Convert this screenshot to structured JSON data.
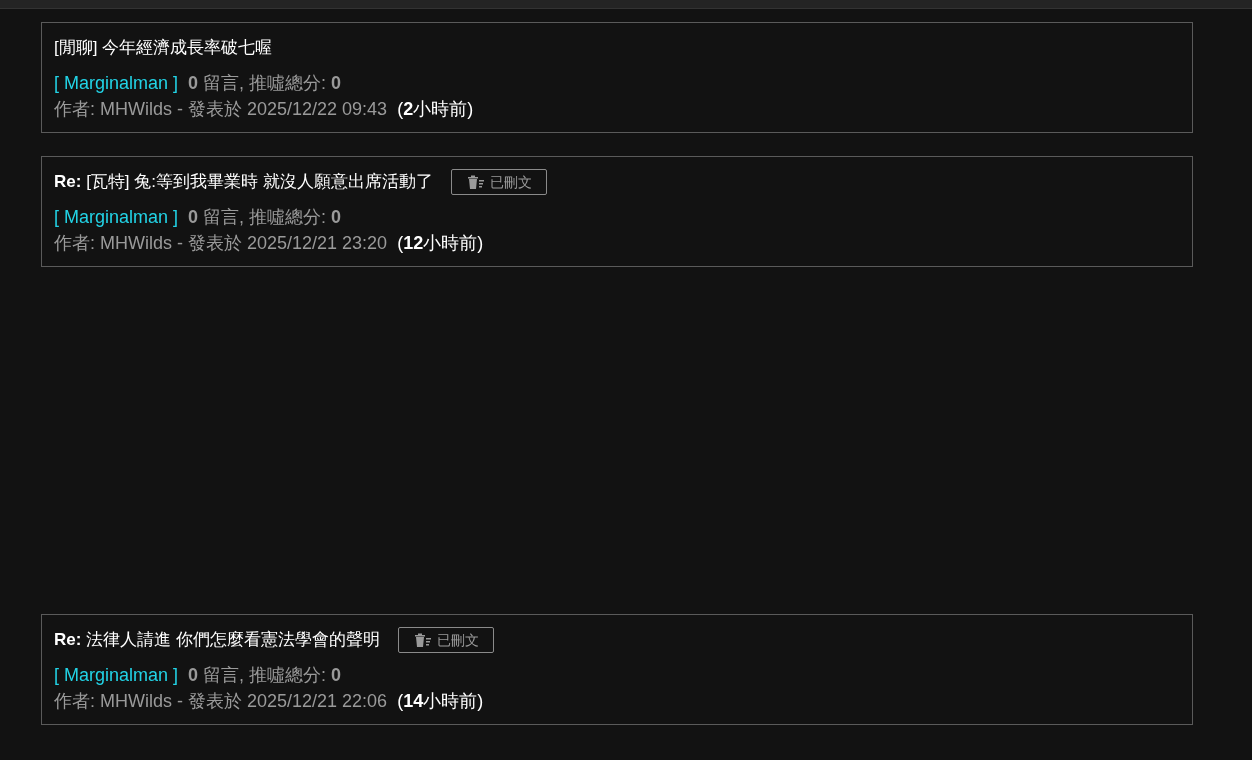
{
  "posts": [
    {
      "title": "[閒聊] 今年經濟成長率破七喔",
      "deleted": false,
      "board": "[ Marginalman ]",
      "stats": "**0** 留言, 推噓總分: **0**",
      "byline": "作者: MHWilds - 發表於 2025/12/22 09:43",
      "ago": "(**2**小時前)"
    },
    {
      "title": "**Re:** [瓦特] 兔:等到我畢業時 就沒人願意出席活動了",
      "deleted": true,
      "deleted_label": "已刪文",
      "board": "[ Marginalman ]",
      "stats": "**0** 留言, 推噓總分: **0**",
      "byline": "作者: MHWilds - 發表於 2025/12/21 23:20",
      "ago": "(**12**小時前)"
    },
    {
      "title": "**Re:** 法律人請進 你們怎麼看憲法學會的聲明",
      "deleted": true,
      "deleted_label": "已刪文",
      "board": "[ Marginalman ]",
      "stats": "**0** 留言, 推噓總分: **0**",
      "byline": "作者: MHWilds - 發表於 2025/12/21 22:06",
      "ago": "(**14**小時前)"
    }
  ]
}
